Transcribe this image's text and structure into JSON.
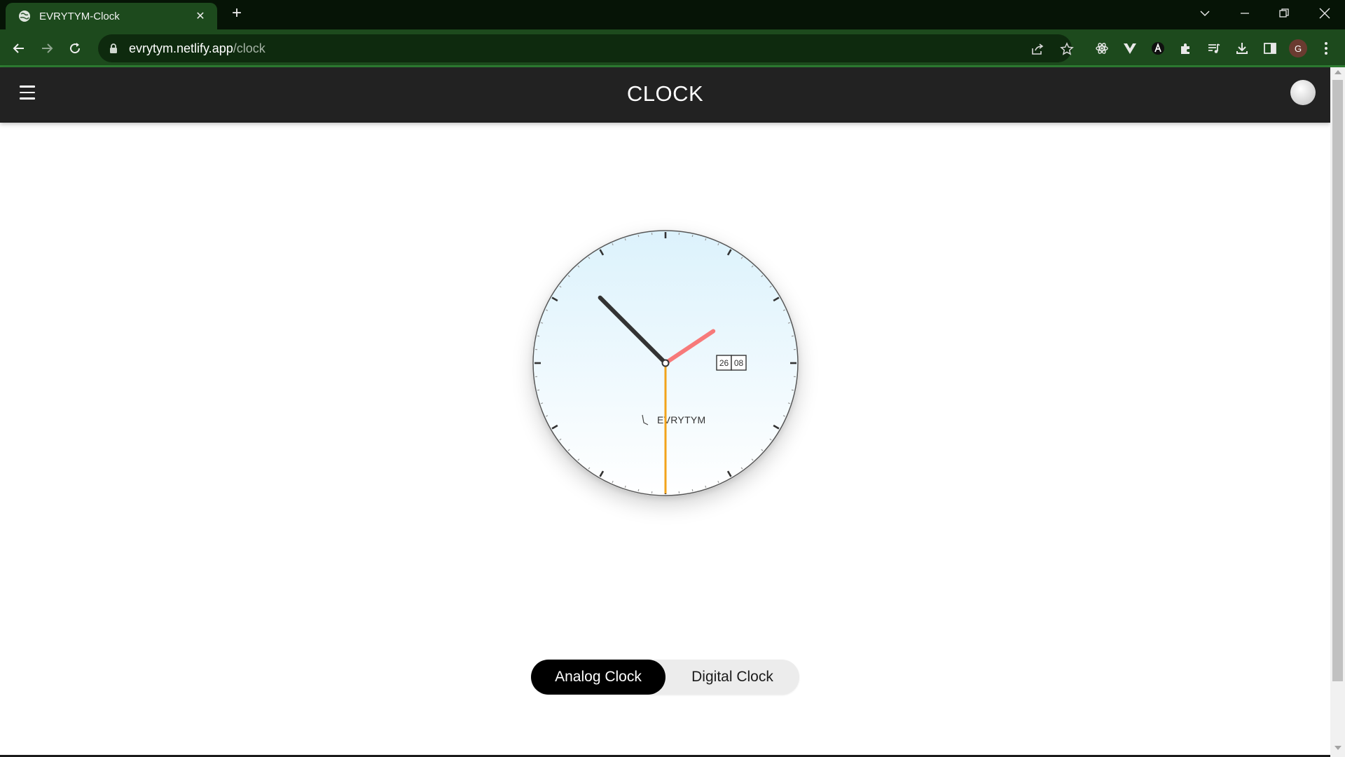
{
  "browser": {
    "tab_title": "EVRYTYM-Clock",
    "url_domain": "evrytym.netlify.app",
    "url_path": "/clock",
    "profile_initial": "G"
  },
  "app": {
    "title": "CLOCK"
  },
  "clock": {
    "brand": "EVRYTYM",
    "date_day": "26",
    "date_month": "08",
    "hour": 1,
    "minute": 52,
    "second": 30,
    "colors": {
      "face_top": "#dcf2fc",
      "face_bottom": "#ffffff",
      "hour_hand": "#f77a7a",
      "minute_hand": "#333333",
      "second_hand": "#f2a31b"
    }
  },
  "toggle": {
    "analog_label": "Analog Clock",
    "digital_label": "Digital Clock",
    "active": "Analog Clock"
  }
}
